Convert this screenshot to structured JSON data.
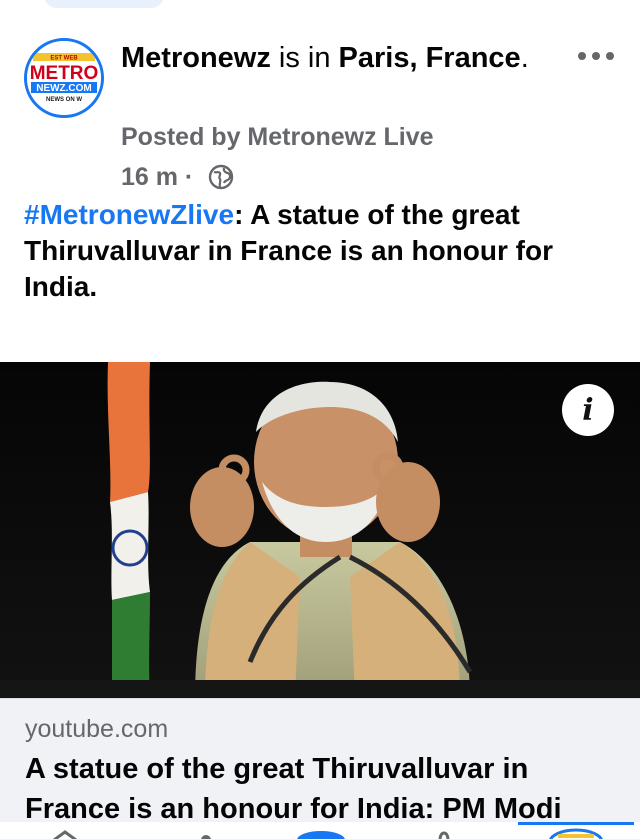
{
  "post": {
    "page_name": "Metronewz",
    "is_in": " is in ",
    "location": "Paris, France",
    "location_suffix": ".",
    "posted_by": "Posted by Metronewz Live",
    "time": "16 m",
    "time_separator": " · ",
    "text_hashtag": "#MetronewZlive",
    "text_body": ": A statue of the great Thiruvalluvar in France is an honour for India."
  },
  "avatar_logo": {
    "top_text": "EST WEB",
    "line1": "METRO",
    "line2": "NEWZ.COM",
    "bottom_text": "NEWS ON W"
  },
  "link_card": {
    "domain": "youtube.com",
    "title": "A statue of the great Thiruvalluvar in France is an honour for India: PM Modi"
  },
  "media": {
    "info_label": "i"
  },
  "icons": {
    "more": "more-options-icon",
    "globe": "globe-icon",
    "info": "info-icon"
  },
  "colors": {
    "accent": "#1877f2",
    "secondary_text": "#65676b"
  }
}
